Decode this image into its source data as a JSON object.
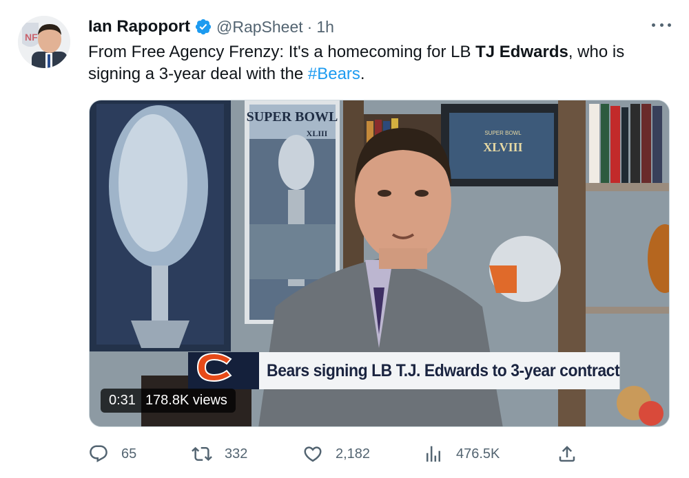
{
  "author": {
    "name": "Ian Rapoport",
    "handle": "@RapSheet",
    "separator": "·",
    "time": "1h",
    "avatar_icon": "avatar-photo",
    "verified_color": "#1d9bf0"
  },
  "tweet": {
    "text_1": "From Free Agency Frenzy: It's a homecoming for LB ",
    "text_bold": "TJ Edwards",
    "text_2": ", who is signing a 3-year deal with the ",
    "hashtag": "#Bears",
    "text_3": "."
  },
  "media": {
    "chyron": "Bears signing LB T.J. Edwards to 3-year contract",
    "duration": "0:31",
    "views": "178.8K views",
    "poster_title": "SUPER BOWL",
    "poster_sub": "XLIII",
    "frame_title": "SUPER BOWL",
    "frame_sub": "XLVIII"
  },
  "actions": {
    "replies": "65",
    "retweets": "332",
    "likes": "2,182",
    "views": "476.5K"
  },
  "colors": {
    "accent": "#1d9bf0",
    "muted": "#536471",
    "bears_navy": "#14203b",
    "bears_orange": "#e64a19"
  }
}
